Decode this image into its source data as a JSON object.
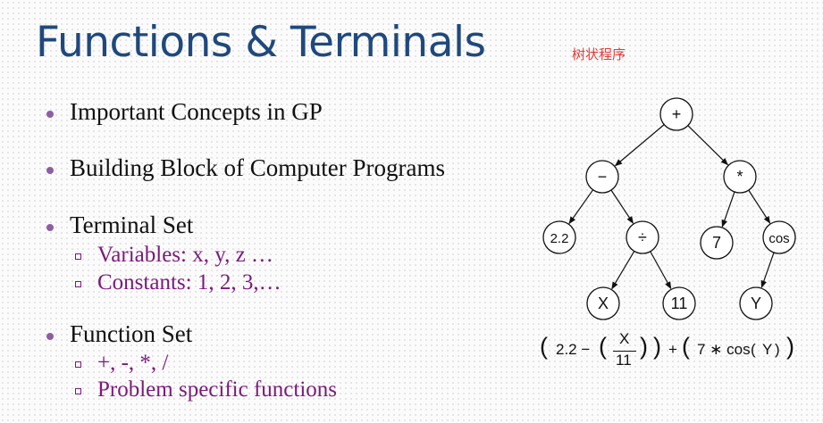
{
  "title": "Functions & Terminals",
  "annotation": "树状程序",
  "bullets": [
    {
      "text": "Important Concepts in GP"
    },
    {
      "text": "Building Block of Computer Programs"
    },
    {
      "text": "Terminal Set",
      "sub": [
        "Variables: x, y, z …",
        "Constants: 1, 2, 3,…"
      ]
    },
    {
      "text": "Function Set",
      "sub": [
        "+, -, *, /",
        "Problem specific functions"
      ]
    }
  ],
  "tree": {
    "nodes": [
      {
        "id": "plus",
        "label": "+"
      },
      {
        "id": "minus",
        "label": "−"
      },
      {
        "id": "times",
        "label": "*"
      },
      {
        "id": "n22",
        "label": "2.2"
      },
      {
        "id": "div",
        "label": "÷"
      },
      {
        "id": "n7",
        "label": "7"
      },
      {
        "id": "cos",
        "label": "cos"
      },
      {
        "id": "x",
        "label": "X"
      },
      {
        "id": "n11",
        "label": "11"
      },
      {
        "id": "y",
        "label": "Y"
      }
    ],
    "edges": [
      [
        "plus",
        "minus"
      ],
      [
        "plus",
        "times"
      ],
      [
        "minus",
        "n22"
      ],
      [
        "minus",
        "div"
      ],
      [
        "times",
        "n7"
      ],
      [
        "times",
        "cos"
      ],
      [
        "div",
        "x"
      ],
      [
        "div",
        "n11"
      ],
      [
        "cos",
        "y"
      ]
    ]
  },
  "formula": {
    "open1": "(",
    "term1": "2.2 −",
    "open2": "(",
    "numerator": "X",
    "denominator": "11",
    "close2": ")",
    "close1": ")",
    "plus": "+",
    "open3": "(",
    "term2": "7 ∗ cos",
    "open4": "(",
    "var": "Y",
    "close4": ")",
    "close3": ")"
  }
}
